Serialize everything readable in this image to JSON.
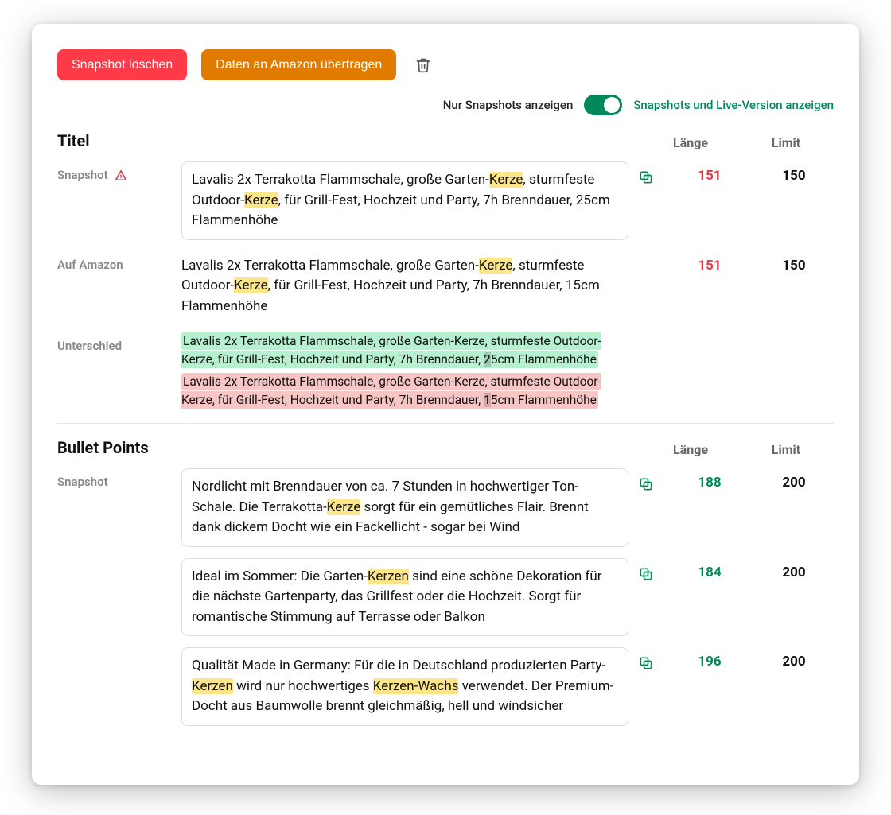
{
  "actions": {
    "delete_snapshot": "Snapshot löschen",
    "transfer_amazon": "Daten an Amazon übertragen"
  },
  "toggle": {
    "left": "Nur Snapshots anzeigen",
    "right": "Snapshots und Live-Version anzeigen",
    "state": "right"
  },
  "columns": {
    "length": "Länge",
    "limit": "Limit"
  },
  "labels": {
    "snapshot": "Snapshot",
    "on_amazon": "Auf Amazon",
    "difference": "Unterschied"
  },
  "titleSection": {
    "heading": "Titel",
    "snapshot": {
      "text_segments": [
        {
          "t": "Lavalis 2x Terrakotta Flammschale, große Garten-",
          "hl": false
        },
        {
          "t": "Kerze",
          "hl": true
        },
        {
          "t": ", sturmfeste Outdoor-",
          "hl": false
        },
        {
          "t": "Kerze",
          "hl": true
        },
        {
          "t": ", für Grill-Fest, Hochzeit und Party, 7h Brenndauer, 25cm Flammenhöhe",
          "hl": false
        }
      ],
      "length": "151",
      "limit": "150",
      "length_status": "over",
      "warning": true
    },
    "amazon": {
      "text_segments": [
        {
          "t": "Lavalis 2x Terrakotta Flammschale, große Garten-",
          "hl": false
        },
        {
          "t": "Kerze",
          "hl": true
        },
        {
          "t": ", sturmfeste Outdoor-",
          "hl": false
        },
        {
          "t": "Kerze",
          "hl": true
        },
        {
          "t": ", für Grill-Fest, Hochzeit und Party, 7h Brenndauer, 15cm Flammenhöhe",
          "hl": false
        }
      ],
      "length": "151",
      "limit": "150",
      "length_status": "over"
    },
    "diff": {
      "added": {
        "prefix": "Lavalis 2x Terrakotta Flammschale, große Garten-Kerze, sturmfeste Outdoor-Kerze, für Grill-Fest, Hochzeit und Party, 7h Brenndauer, ",
        "char": "2",
        "suffix": "5cm Flammenhöhe"
      },
      "removed": {
        "prefix": "Lavalis 2x Terrakotta Flammschale, große Garten-Kerze, sturmfeste Outdoor-Kerze, für Grill-Fest, Hochzeit und Party, 7h Brenndauer, ",
        "char": "1",
        "suffix": "5cm Flammenhöhe"
      }
    }
  },
  "bulletSection": {
    "heading": "Bullet Points",
    "items": [
      {
        "text_segments": [
          {
            "t": "Nordlicht mit Brenndauer von ca. 7 Stunden in hochwertiger Ton-Schale. Die Terrakotta-",
            "hl": false
          },
          {
            "t": "Kerze",
            "hl": true
          },
          {
            "t": " sorgt für ein gemütliches Flair. Brennt dank dickem Docht wie ein Fackellicht - sogar bei Wind",
            "hl": false
          }
        ],
        "length": "188",
        "limit": "200",
        "length_status": "ok"
      },
      {
        "text_segments": [
          {
            "t": "Ideal im Sommer: Die Garten-",
            "hl": false
          },
          {
            "t": "Kerzen",
            "hl": true
          },
          {
            "t": " sind eine schöne Dekoration für die nächste Gartenparty, das Grillfest oder die Hochzeit. Sorgt für romantische Stimmung auf Terrasse oder Balkon",
            "hl": false
          }
        ],
        "length": "184",
        "limit": "200",
        "length_status": "ok"
      },
      {
        "text_segments": [
          {
            "t": "Qualität Made in Germany: Für die in Deutschland produzierten Party-",
            "hl": false
          },
          {
            "t": "Kerzen",
            "hl": true
          },
          {
            "t": " wird nur hochwertiges ",
            "hl": false
          },
          {
            "t": "Kerzen-Wachs",
            "hl": true
          },
          {
            "t": " verwendet. Der Premium-Docht aus Baumwolle brennt gleichmäßig, hell und windsicher",
            "hl": false
          }
        ],
        "length": "196",
        "limit": "200",
        "length_status": "ok"
      }
    ]
  }
}
